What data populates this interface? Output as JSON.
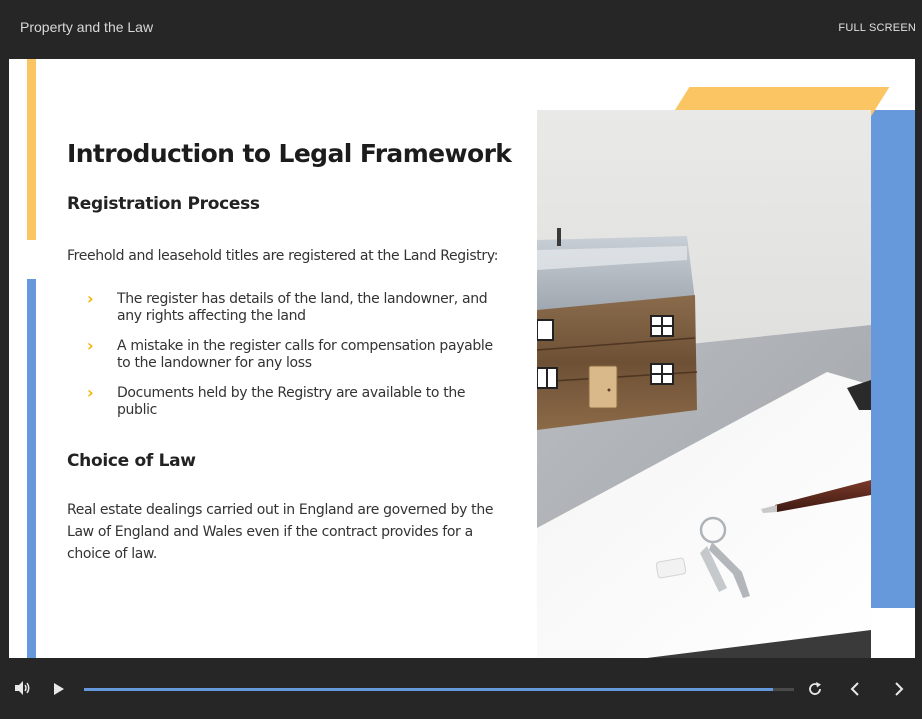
{
  "header": {
    "course_title": "Property and the Law",
    "fullscreen_label": "FULL SCREEN"
  },
  "slide": {
    "title": "Introduction to Legal Framework",
    "section1_heading": "Registration Process",
    "section1_intro": "Freehold and leasehold titles are registered at the Land Registry:",
    "bullets": [
      "The register has details of the land, the landowner, and any rights affecting the land",
      "A mistake in the register calls for compensation payable to the landowner for any loss",
      "Documents held by the Registry are available to the public"
    ],
    "section2_heading": "Choice of Law",
    "section2_body": "Real estate dealings carried out in England are governed by the Law of England and Wales even if the contract provides for a choice of law.",
    "photo_icon": "house-model-keys-clipboard-photo"
  },
  "player": {
    "progress_fraction": 0.97,
    "icons": [
      "volume-icon",
      "play-icon",
      "replay-icon",
      "previous-icon",
      "next-icon"
    ]
  },
  "colors": {
    "accent_yellow": "#fac562",
    "accent_blue": "#6699db",
    "bullet_chevron": "#f5b400",
    "chrome_bg": "#262626"
  }
}
